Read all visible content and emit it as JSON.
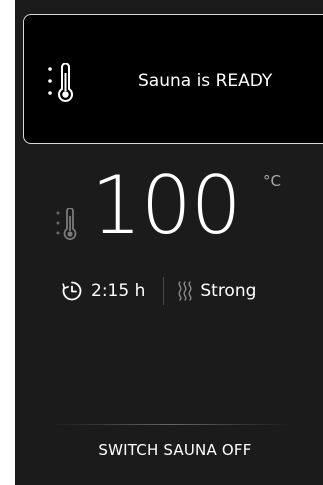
{
  "status": {
    "message": "Sauna is READY",
    "icon": "thermometer-icon"
  },
  "temperature": {
    "value": "100",
    "unit": "°C",
    "icon": "thermometer-icon"
  },
  "session": {
    "time_icon": "clock-icon",
    "time": "2:15 h",
    "mode_icon": "steam-icon",
    "mode": "Strong"
  },
  "actions": {
    "switch_off_label": "SWITCH SAUNA OFF"
  },
  "colors": {
    "background": "#1b1b1b",
    "card_background": "#000000",
    "card_border": "#d9d9d9",
    "text": "#ffffff",
    "muted": "#8a8a8a"
  }
}
